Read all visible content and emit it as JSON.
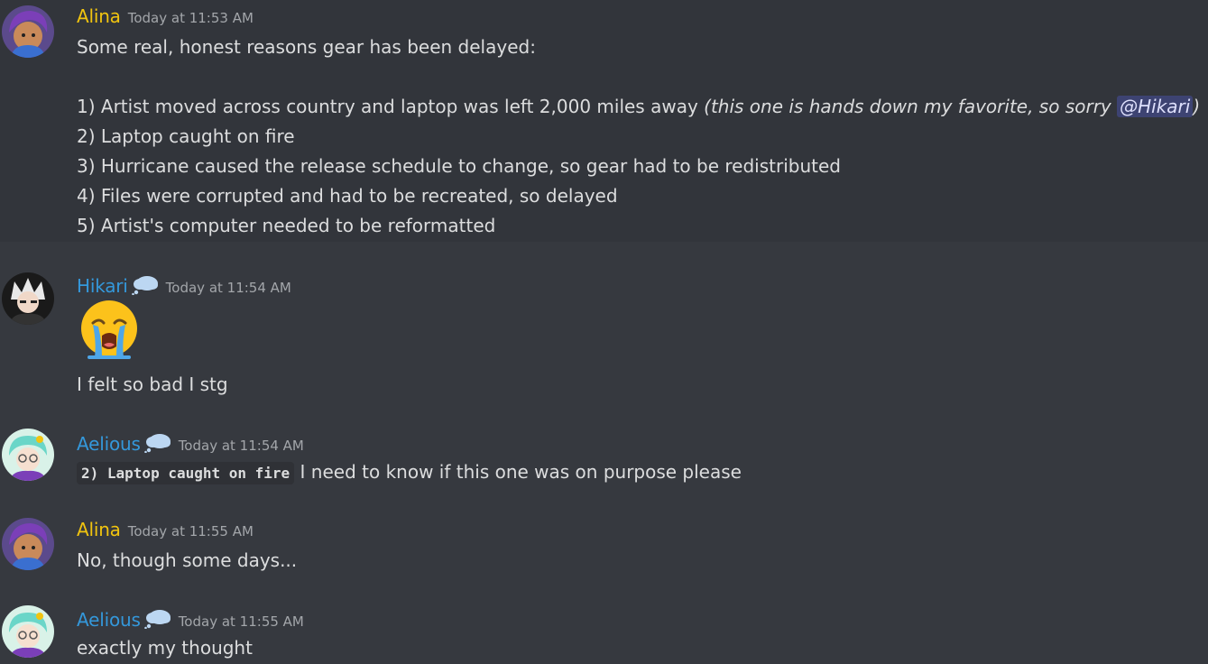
{
  "messages": [
    {
      "author": "Alina",
      "timestamp": "Today at 11:53 AM",
      "lines": [
        "Some real, honest reasons gear has been delayed:",
        "1) Artist moved across country and laptop was left 2,000 miles away ",
        "2) Laptop caught on fire",
        "3) Hurricane caused the release schedule to change, so gear had to be redistributed",
        "4) Files were corrupted and had to be recreated, so delayed",
        "5) Artist's computer needed to be reformatted"
      ],
      "italic_note_prefix": "(this one is hands down my favorite, so sorry ",
      "mention": "@Hikari",
      "italic_note_suffix": ")"
    },
    {
      "author": "Hikari",
      "timestamp": "Today at 11:54 AM",
      "emoji": "loudly-crying-face",
      "text": "I felt so bad I stg"
    },
    {
      "author": "Aelious",
      "timestamp": "Today at 11:54 AM",
      "code": "2) Laptop caught on fire",
      "text": "I need to know if this one was on purpose please"
    },
    {
      "author": "Alina",
      "timestamp": "Today at 11:55 AM",
      "text": "No, though some days..."
    },
    {
      "author": "Aelious",
      "timestamp": "Today at 11:55 AM",
      "text": "exactly my thought"
    }
  ],
  "colors": {
    "background": "#36393f",
    "highlight": "#32353b",
    "alina_name": "#f1c40f",
    "blue_name": "#3498db",
    "timestamp": "#a3a6aa",
    "text": "#dcddde"
  }
}
